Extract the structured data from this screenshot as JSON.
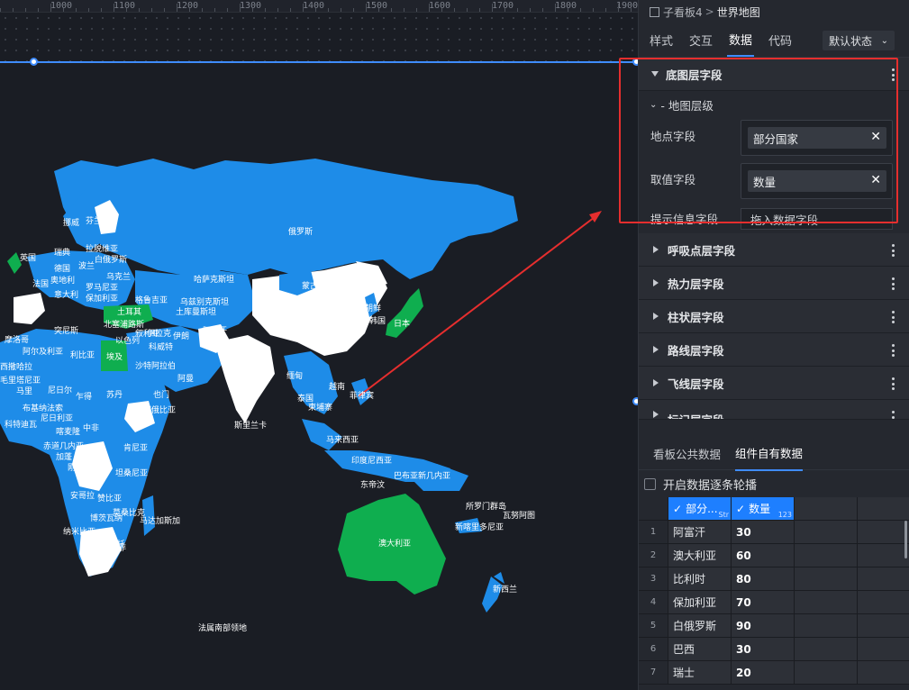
{
  "ruler": {
    "labels": [
      "1000",
      "1100",
      "1200",
      "1300",
      "1400",
      "1500",
      "1600",
      "1700",
      "1800",
      "1900"
    ]
  },
  "map": {
    "labels": [
      "俄罗斯",
      "芬兰",
      "瑞典",
      "挪威",
      "拉脱维亚",
      "白俄罗斯",
      "英国",
      "德国",
      "波兰",
      "乌克兰",
      "法国",
      "奥地利",
      "罗马尼亚",
      "哈萨克斯坦",
      "蒙古",
      "意大利",
      "保加利亚",
      "格鲁吉亚",
      "乌兹别克斯坦",
      "土库曼斯坦",
      "土耳其",
      "北塞浦路斯",
      "以色列",
      "叙利亚",
      "伊拉克",
      "伊朗",
      "阿富汗",
      "科威特",
      "沙特阿拉伯",
      "阿曼",
      "也门",
      "埃及",
      "利比亚",
      "突尼斯",
      "阿尔及利亚",
      "摩洛哥",
      "西撒哈拉",
      "马里",
      "尼日尔",
      "乍得",
      "苏丹",
      "埃塞俄比亚",
      "毛里塔尼亚",
      "尼日利亚",
      "布基纳法索",
      "科特迪瓦",
      "喀麦隆",
      "中非",
      "赤道几内亚",
      "加蓬",
      "刚果",
      "坦桑尼亚",
      "肯尼亚",
      "安哥拉",
      "赞比亚",
      "纳米比亚",
      "博茨瓦纳",
      "莫桑比克",
      "马达加斯加",
      "南非",
      "莱索托",
      "日本",
      "韩国",
      "朝鲜",
      "菲律宾",
      "泰国",
      "柬埔寨",
      "越南",
      "缅甸",
      "斯里兰卡",
      "马来西亚",
      "印度尼西亚",
      "东帝汶",
      "巴布亚新几内亚",
      "所罗门群岛",
      "瓦努阿图",
      "新喀里多尼亚",
      "澳大利亚",
      "新西兰",
      "法属南部领地"
    ]
  },
  "breadcrumb": {
    "parent": "子看板4",
    "separator": ">",
    "current": "世界地图"
  },
  "tabs": [
    "样式",
    "交互",
    "数据",
    "代码"
  ],
  "state_select": {
    "value": "默认状态"
  },
  "base_layer": {
    "title": "底图层字段",
    "sub_title": "- 地图层级",
    "fields": [
      {
        "label": "地点字段",
        "value": "部分国家"
      },
      {
        "label": "取值字段",
        "value": "数量"
      }
    ],
    "tooltip_field": {
      "label": "提示信息字段",
      "placeholder": "拖入数据字段"
    }
  },
  "layers": [
    "呼吸点层字段",
    "热力层字段",
    "柱状层字段",
    "路线层字段",
    "飞线层字段",
    "标记层字段"
  ],
  "bottom_tabs": [
    "看板公共数据",
    "组件自有数据"
  ],
  "carousel_label": "开启数据逐条轮播",
  "grid": {
    "columns": [
      {
        "name": "部分...",
        "type": "Str"
      },
      {
        "name": "数量",
        "type": "123"
      }
    ],
    "rows": [
      {
        "idx": "1",
        "country": "阿富汗",
        "value": "30"
      },
      {
        "idx": "2",
        "country": "澳大利亚",
        "value": "60"
      },
      {
        "idx": "3",
        "country": "比利时",
        "value": "80"
      },
      {
        "idx": "4",
        "country": "保加利亚",
        "value": "70"
      },
      {
        "idx": "5",
        "country": "白俄罗斯",
        "value": "90"
      },
      {
        "idx": "6",
        "country": "巴西",
        "value": "30"
      },
      {
        "idx": "7",
        "country": "瑞士",
        "value": "20"
      }
    ]
  },
  "colors": {
    "accent": "#3f8cff",
    "map_blue": "#1e8ce8",
    "map_green": "#0fae4f",
    "map_white": "#ffffff",
    "annotation_red": "#e62e2e"
  }
}
